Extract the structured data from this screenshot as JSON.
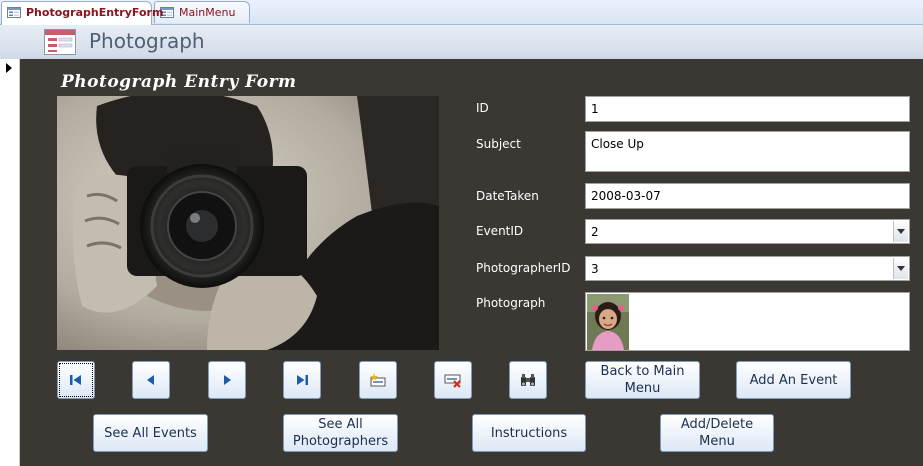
{
  "tabs": [
    {
      "label": "PhotographEntryForm",
      "active": true
    },
    {
      "label": "MainMenu",
      "active": false
    }
  ],
  "header": {
    "title": "Photograph"
  },
  "form": {
    "title": "Photograph Entry Form",
    "fields": {
      "id": {
        "label": "ID",
        "value": "1"
      },
      "subject": {
        "label": "Subject",
        "value": "Close Up"
      },
      "date_taken": {
        "label": "DateTaken",
        "value": "2008-03-07"
      },
      "event_id": {
        "label": "EventID",
        "value": "2"
      },
      "photographer_id": {
        "label": "PhotographerID",
        "value": "3"
      },
      "photograph": {
        "label": "Photograph"
      }
    },
    "nav_icons": [
      "first-record-icon",
      "previous-record-icon",
      "next-record-icon",
      "last-record-icon",
      "new-record-icon",
      "delete-record-icon",
      "find-icon"
    ],
    "buttons": {
      "back_main_menu": "Back to Main\nMenu",
      "add_event": "Add An Event",
      "see_all_events": "See All Events",
      "see_all_photographers": "See All\nPhotographers",
      "instructions": "Instructions",
      "add_delete_menu": "Add/Delete\nMenu"
    }
  },
  "colors": {
    "form_background": "#3b3833",
    "tab_text": "#8a1420",
    "header_text": "#4f5f74",
    "button_text": "#1d2f4f"
  }
}
